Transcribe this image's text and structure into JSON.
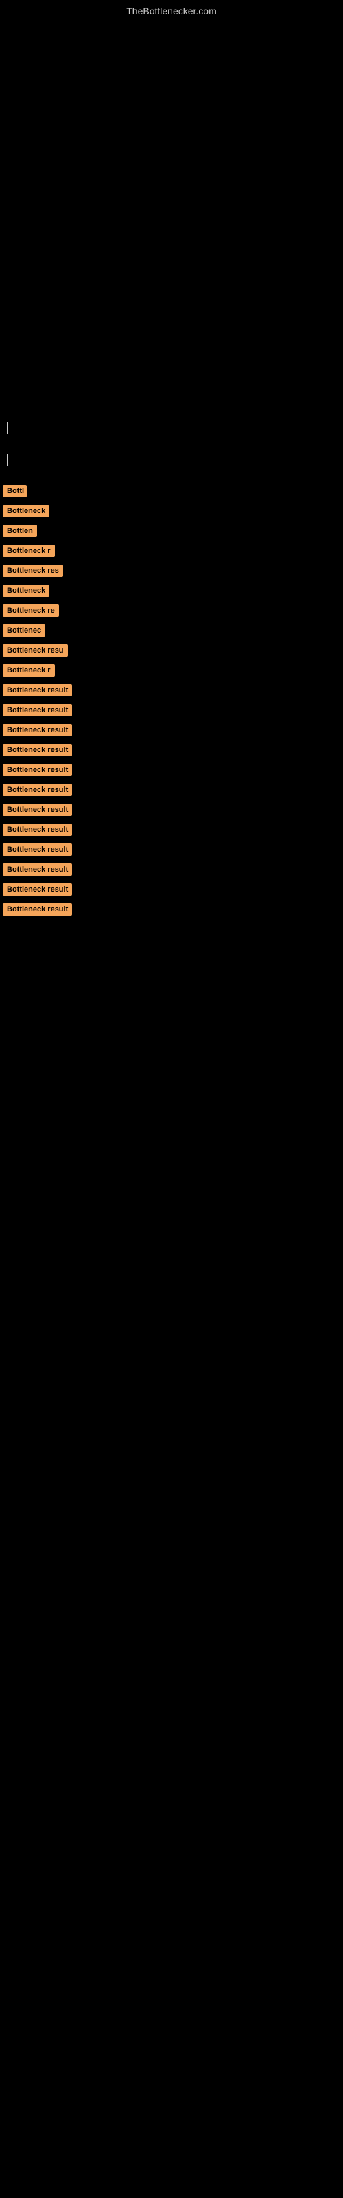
{
  "site": {
    "title": "TheBottlenecker.com"
  },
  "results": [
    {
      "label": "Bottl",
      "width": 35
    },
    {
      "label": "Bottleneck",
      "width": 68
    },
    {
      "label": "Bottlen",
      "width": 50
    },
    {
      "label": "Bottleneck r",
      "width": 76
    },
    {
      "label": "Bottleneck res",
      "width": 90
    },
    {
      "label": "Bottleneck",
      "width": 68
    },
    {
      "label": "Bottleneck re",
      "width": 84
    },
    {
      "label": "Bottlenec",
      "width": 62
    },
    {
      "label": "Bottleneck resu",
      "width": 96
    },
    {
      "label": "Bottleneck r",
      "width": 76
    },
    {
      "label": "Bottleneck result",
      "width": 105
    },
    {
      "label": "Bottleneck result",
      "width": 105
    },
    {
      "label": "Bottleneck result",
      "width": 105
    },
    {
      "label": "Bottleneck result",
      "width": 105
    },
    {
      "label": "Bottleneck result",
      "width": 105
    },
    {
      "label": "Bottleneck result",
      "width": 105
    },
    {
      "label": "Bottleneck result",
      "width": 105
    },
    {
      "label": "Bottleneck result",
      "width": 105
    },
    {
      "label": "Bottleneck result",
      "width": 105
    },
    {
      "label": "Bottleneck result",
      "width": 105
    },
    {
      "label": "Bottleneck result",
      "width": 105
    },
    {
      "label": "Bottleneck result",
      "width": 105
    }
  ],
  "accent_color": "#f5a55a"
}
